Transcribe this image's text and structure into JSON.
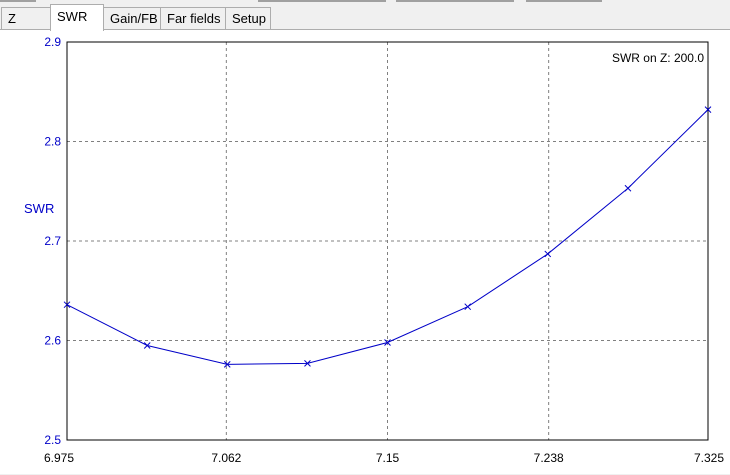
{
  "tabs": [
    {
      "label": "Z",
      "active": false
    },
    {
      "label": "SWR",
      "active": true
    },
    {
      "label": "Gain/FB",
      "active": false
    },
    {
      "label": "Far fields",
      "active": false
    },
    {
      "label": "Setup",
      "active": false
    }
  ],
  "chart_data": {
    "type": "line",
    "ylabel": "SWR",
    "annotation": "SWR on Z: 200.0",
    "xlim": [
      6.975,
      7.325
    ],
    "ylim": [
      2.5,
      2.9
    ],
    "x_ticks": [
      "6.975",
      "7.062",
      "7.15",
      "7.238",
      "7.325"
    ],
    "y_ticks": [
      "2.5",
      "2.6",
      "2.7",
      "2.8",
      "2.9"
    ],
    "grid": true,
    "series_color": "#0000c8",
    "x": [
      6.975,
      7.0188,
      7.0625,
      7.1063,
      7.15,
      7.1938,
      7.2375,
      7.2813,
      7.325
    ],
    "values": [
      2.636,
      2.595,
      2.576,
      2.577,
      2.598,
      2.634,
      2.687,
      2.753,
      2.832
    ]
  }
}
